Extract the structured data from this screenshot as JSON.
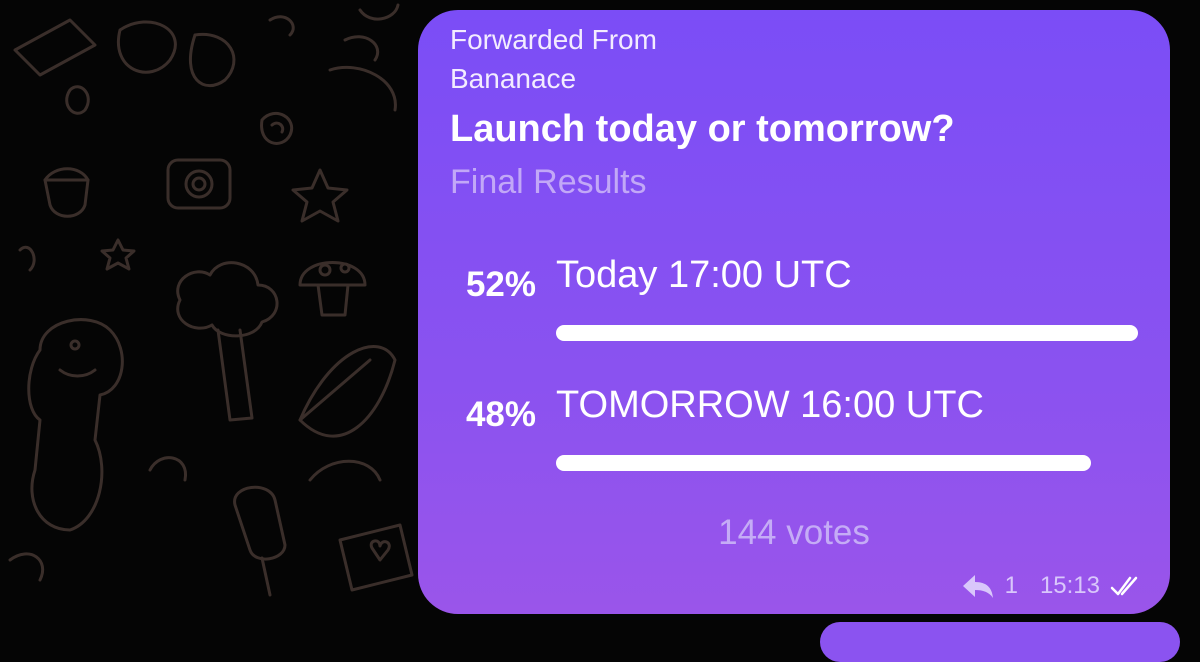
{
  "message": {
    "forwarded_label": "Forwarded From",
    "forwarded_name": "Bananace",
    "question": "Launch today or tomorrow?",
    "status": "Final Results",
    "options": [
      {
        "percent": "52%",
        "label": "Today 17:00 UTC",
        "fill": 1.0
      },
      {
        "percent": "48%",
        "label": "TOMORROW 16:00 UTC",
        "fill": 0.92
      }
    ],
    "votes": "144 votes",
    "reply_count": "1",
    "time": "15:13",
    "icons": {
      "reply": "reply-arrow-icon",
      "status": "double-check-icon"
    }
  },
  "colors": {
    "background": "#050505",
    "bubble": "#8250f2",
    "bar": "#ffffff",
    "muted_text": "#c5acf6"
  }
}
